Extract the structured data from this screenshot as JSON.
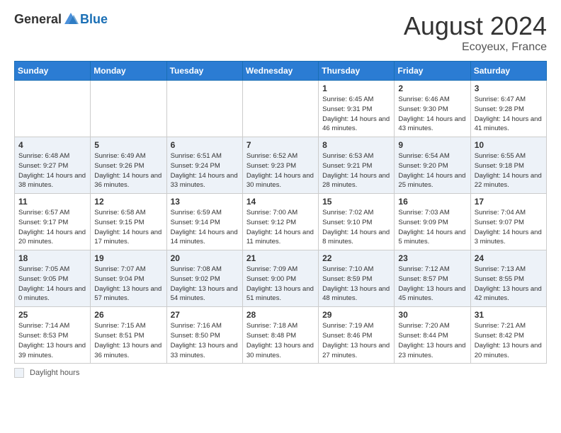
{
  "header": {
    "logo_general": "General",
    "logo_blue": "Blue",
    "month_year": "August 2024",
    "location": "Ecoyeux, France"
  },
  "footer": {
    "daylight_label": "Daylight hours"
  },
  "days_of_week": [
    "Sunday",
    "Monday",
    "Tuesday",
    "Wednesday",
    "Thursday",
    "Friday",
    "Saturday"
  ],
  "weeks": [
    [
      {
        "day": "",
        "info": ""
      },
      {
        "day": "",
        "info": ""
      },
      {
        "day": "",
        "info": ""
      },
      {
        "day": "",
        "info": ""
      },
      {
        "day": "1",
        "info": "Sunrise: 6:45 AM\nSunset: 9:31 PM\nDaylight: 14 hours\nand 46 minutes."
      },
      {
        "day": "2",
        "info": "Sunrise: 6:46 AM\nSunset: 9:30 PM\nDaylight: 14 hours\nand 43 minutes."
      },
      {
        "day": "3",
        "info": "Sunrise: 6:47 AM\nSunset: 9:28 PM\nDaylight: 14 hours\nand 41 minutes."
      }
    ],
    [
      {
        "day": "4",
        "info": "Sunrise: 6:48 AM\nSunset: 9:27 PM\nDaylight: 14 hours\nand 38 minutes."
      },
      {
        "day": "5",
        "info": "Sunrise: 6:49 AM\nSunset: 9:26 PM\nDaylight: 14 hours\nand 36 minutes."
      },
      {
        "day": "6",
        "info": "Sunrise: 6:51 AM\nSunset: 9:24 PM\nDaylight: 14 hours\nand 33 minutes."
      },
      {
        "day": "7",
        "info": "Sunrise: 6:52 AM\nSunset: 9:23 PM\nDaylight: 14 hours\nand 30 minutes."
      },
      {
        "day": "8",
        "info": "Sunrise: 6:53 AM\nSunset: 9:21 PM\nDaylight: 14 hours\nand 28 minutes."
      },
      {
        "day": "9",
        "info": "Sunrise: 6:54 AM\nSunset: 9:20 PM\nDaylight: 14 hours\nand 25 minutes."
      },
      {
        "day": "10",
        "info": "Sunrise: 6:55 AM\nSunset: 9:18 PM\nDaylight: 14 hours\nand 22 minutes."
      }
    ],
    [
      {
        "day": "11",
        "info": "Sunrise: 6:57 AM\nSunset: 9:17 PM\nDaylight: 14 hours\nand 20 minutes."
      },
      {
        "day": "12",
        "info": "Sunrise: 6:58 AM\nSunset: 9:15 PM\nDaylight: 14 hours\nand 17 minutes."
      },
      {
        "day": "13",
        "info": "Sunrise: 6:59 AM\nSunset: 9:14 PM\nDaylight: 14 hours\nand 14 minutes."
      },
      {
        "day": "14",
        "info": "Sunrise: 7:00 AM\nSunset: 9:12 PM\nDaylight: 14 hours\nand 11 minutes."
      },
      {
        "day": "15",
        "info": "Sunrise: 7:02 AM\nSunset: 9:10 PM\nDaylight: 14 hours\nand 8 minutes."
      },
      {
        "day": "16",
        "info": "Sunrise: 7:03 AM\nSunset: 9:09 PM\nDaylight: 14 hours\nand 5 minutes."
      },
      {
        "day": "17",
        "info": "Sunrise: 7:04 AM\nSunset: 9:07 PM\nDaylight: 14 hours\nand 3 minutes."
      }
    ],
    [
      {
        "day": "18",
        "info": "Sunrise: 7:05 AM\nSunset: 9:05 PM\nDaylight: 14 hours\nand 0 minutes."
      },
      {
        "day": "19",
        "info": "Sunrise: 7:07 AM\nSunset: 9:04 PM\nDaylight: 13 hours\nand 57 minutes."
      },
      {
        "day": "20",
        "info": "Sunrise: 7:08 AM\nSunset: 9:02 PM\nDaylight: 13 hours\nand 54 minutes."
      },
      {
        "day": "21",
        "info": "Sunrise: 7:09 AM\nSunset: 9:00 PM\nDaylight: 13 hours\nand 51 minutes."
      },
      {
        "day": "22",
        "info": "Sunrise: 7:10 AM\nSunset: 8:59 PM\nDaylight: 13 hours\nand 48 minutes."
      },
      {
        "day": "23",
        "info": "Sunrise: 7:12 AM\nSunset: 8:57 PM\nDaylight: 13 hours\nand 45 minutes."
      },
      {
        "day": "24",
        "info": "Sunrise: 7:13 AM\nSunset: 8:55 PM\nDaylight: 13 hours\nand 42 minutes."
      }
    ],
    [
      {
        "day": "25",
        "info": "Sunrise: 7:14 AM\nSunset: 8:53 PM\nDaylight: 13 hours\nand 39 minutes."
      },
      {
        "day": "26",
        "info": "Sunrise: 7:15 AM\nSunset: 8:51 PM\nDaylight: 13 hours\nand 36 minutes."
      },
      {
        "day": "27",
        "info": "Sunrise: 7:16 AM\nSunset: 8:50 PM\nDaylight: 13 hours\nand 33 minutes."
      },
      {
        "day": "28",
        "info": "Sunrise: 7:18 AM\nSunset: 8:48 PM\nDaylight: 13 hours\nand 30 minutes."
      },
      {
        "day": "29",
        "info": "Sunrise: 7:19 AM\nSunset: 8:46 PM\nDaylight: 13 hours\nand 27 minutes."
      },
      {
        "day": "30",
        "info": "Sunrise: 7:20 AM\nSunset: 8:44 PM\nDaylight: 13 hours\nand 23 minutes."
      },
      {
        "day": "31",
        "info": "Sunrise: 7:21 AM\nSunset: 8:42 PM\nDaylight: 13 hours\nand 20 minutes."
      }
    ]
  ]
}
